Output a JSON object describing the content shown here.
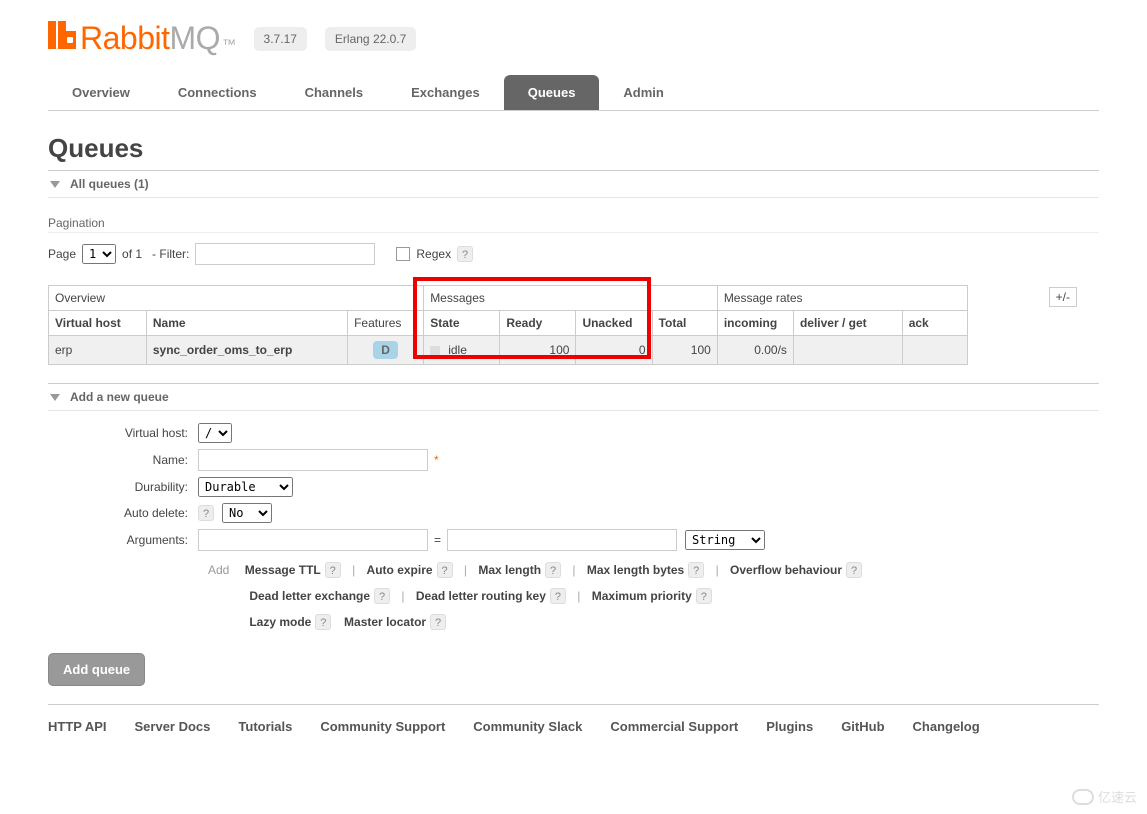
{
  "header": {
    "brand1": "Rabbit",
    "brand2": "MQ",
    "version": "3.7.17",
    "erlang": "Erlang 22.0.7"
  },
  "tabs": [
    "Overview",
    "Connections",
    "Channels",
    "Exchanges",
    "Queues",
    "Admin"
  ],
  "tabs_active_index": 4,
  "page_title": "Queues",
  "all_queues_label": "All queues (1)",
  "pagination": {
    "label": "Pagination",
    "page_label": "Page",
    "page_value": "1",
    "of_label": "of 1",
    "filter_label": "- Filter:",
    "regex_label": "Regex",
    "help": "?"
  },
  "table": {
    "plusminus": "+/-",
    "group_overview": "Overview",
    "group_messages": "Messages",
    "group_rates": "Message rates",
    "cols": {
      "vhost": "Virtual host",
      "name": "Name",
      "features": "Features",
      "state": "State",
      "ready": "Ready",
      "unacked": "Unacked",
      "total": "Total",
      "incoming": "incoming",
      "deliver": "deliver / get",
      "ack": "ack"
    },
    "row": {
      "vhost": "erp",
      "name": "sync_order_oms_to_erp",
      "feature": "D",
      "state": "idle",
      "ready": "100",
      "unacked": "0",
      "total": "100",
      "incoming": "0.00/s",
      "deliver": "",
      "ack": ""
    }
  },
  "addqueue": {
    "title": "Add a new queue",
    "labels": {
      "vhost": "Virtual host:",
      "name": "Name:",
      "durability": "Durability:",
      "autodelete": "Auto delete:",
      "arguments": "Arguments:"
    },
    "vhost_value": "/",
    "durability_value": "Durable",
    "autodelete_value": "No",
    "arg_type": "String",
    "eq": "=",
    "req": "*",
    "help": "?",
    "add_label": "Add",
    "hints_row1": [
      "Message TTL",
      "Auto expire",
      "Max length",
      "Max length bytes",
      "Overflow behaviour"
    ],
    "hints_row2": [
      "Dead letter exchange",
      "Dead letter routing key",
      "Maximum priority"
    ],
    "hints_row3": [
      "Lazy mode",
      "Master locator"
    ],
    "sep": "|",
    "button": "Add queue"
  },
  "footer": [
    "HTTP API",
    "Server Docs",
    "Tutorials",
    "Community Support",
    "Community Slack",
    "Commercial Support",
    "Plugins",
    "GitHub",
    "Changelog"
  ],
  "watermark": "亿速云"
}
